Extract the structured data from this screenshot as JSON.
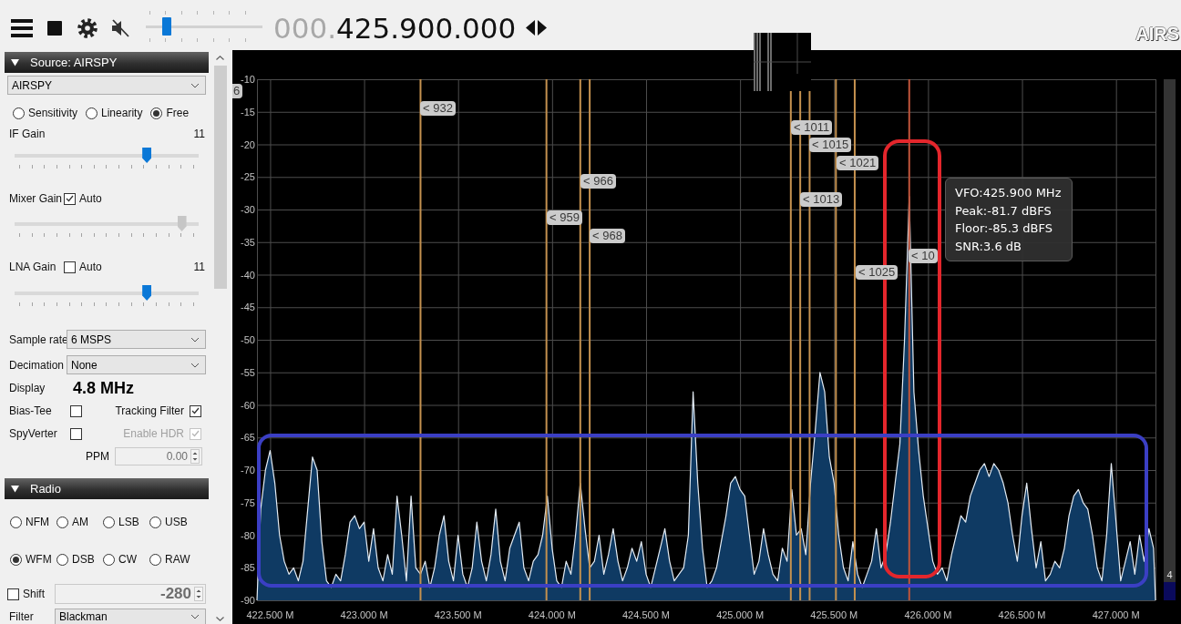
{
  "toolbar": {
    "running": true,
    "muted": true,
    "volume": {
      "level": 0.15
    },
    "frequency": {
      "leading": "000.",
      "main": "425.900.000"
    },
    "logo": "AIRS"
  },
  "source_panel": {
    "title": "Source: AIRSPY",
    "expanded": true,
    "device": "AIRSPY",
    "modes": [
      {
        "label": "Sensitivity",
        "selected": false
      },
      {
        "label": "Linearity",
        "selected": false
      },
      {
        "label": "Free",
        "selected": true
      }
    ],
    "gains": [
      {
        "label": "IF Gain",
        "value": "11",
        "level": 0.73,
        "disabled": false
      },
      {
        "label": "Mixer Gain",
        "auto": {
          "label": "Auto",
          "checked": true
        },
        "level": 0.93,
        "disabled": true
      },
      {
        "label": "LNA Gain",
        "auto": {
          "label": "Auto",
          "checked": false
        },
        "value": "11",
        "level": 0.73,
        "disabled": false
      }
    ],
    "sample_rate": {
      "label": "Sample rate",
      "value": "6 MSPS"
    },
    "decimation": {
      "label": "Decimation",
      "value": "None"
    },
    "display": {
      "label": "Display",
      "value": "4.8 MHz"
    },
    "options": [
      {
        "label": "Bias-Tee",
        "checked": false,
        "disabled": false
      },
      {
        "label": "Tracking Filter",
        "checked": true,
        "disabled": false
      },
      {
        "label": "SpyVerter",
        "checked": false,
        "disabled": false
      },
      {
        "label": "Enable HDR",
        "checked": true,
        "disabled": true
      }
    ],
    "ppm": {
      "label": "PPM",
      "value": "0.00",
      "disabled": true
    }
  },
  "radio_panel": {
    "title": "Radio",
    "expanded": true,
    "modes": [
      {
        "label": "NFM",
        "selected": false
      },
      {
        "label": "AM",
        "selected": false
      },
      {
        "label": "LSB",
        "selected": false
      },
      {
        "label": "USB",
        "selected": false
      },
      {
        "label": "WFM",
        "selected": true
      },
      {
        "label": "DSB",
        "selected": false
      },
      {
        "label": "CW",
        "selected": false
      },
      {
        "label": "RAW",
        "selected": false
      }
    ],
    "shift": {
      "label": "Shift",
      "checked": false,
      "value": "-280"
    },
    "filter": {
      "label": "Filter",
      "value": "Blackman"
    }
  },
  "spectrum": {
    "chart_data": {
      "type": "area",
      "grid": true,
      "xlim": [
        422.43,
        427.21
      ],
      "ylim": [
        -90,
        -10
      ],
      "xticks": [
        {
          "value": 422.5,
          "label": "422.500 M"
        },
        {
          "value": 423,
          "label": "423.000 M"
        },
        {
          "value": 423.5,
          "label": "423.500 M"
        },
        {
          "value": 424,
          "label": "424.000 M"
        },
        {
          "value": 424.5,
          "label": "424.500 M"
        },
        {
          "value": 425,
          "label": "425.000 M"
        },
        {
          "value": 425.5,
          "label": "425.500 M"
        },
        {
          "value": 426,
          "label": "426.000 M"
        },
        {
          "value": 426.5,
          "label": "426.500 M"
        },
        {
          "value": 427,
          "label": "427.000 M"
        }
      ],
      "yticks": [
        -10,
        -15,
        -20,
        -25,
        -30,
        -35,
        -40,
        -45,
        -50,
        -55,
        -60,
        -65,
        -70,
        -75,
        -80,
        -85,
        -90
      ],
      "x": [
        422.43,
        422.45,
        422.475,
        422.5,
        422.525,
        422.55,
        422.575,
        422.6,
        422.625,
        422.65,
        422.675,
        422.7,
        422.725,
        422.75,
        422.775,
        422.8,
        422.825,
        422.85,
        422.875,
        422.9,
        422.925,
        422.95,
        422.975,
        423,
        423.025,
        423.05,
        423.075,
        423.1,
        423.125,
        423.15,
        423.175,
        423.2,
        423.225,
        423.25,
        423.275,
        423.3,
        423.325,
        423.35,
        423.375,
        423.4,
        423.425,
        423.45,
        423.475,
        423.5,
        423.525,
        423.55,
        423.575,
        423.6,
        423.625,
        423.65,
        423.675,
        423.7,
        423.725,
        423.75,
        423.775,
        423.8,
        423.825,
        423.85,
        423.875,
        423.9,
        423.925,
        423.95,
        423.975,
        424,
        424.025,
        424.05,
        424.075,
        424.1,
        424.125,
        424.15,
        424.175,
        424.2,
        424.225,
        424.25,
        424.275,
        424.3,
        424.325,
        424.35,
        424.375,
        424.4,
        424.425,
        424.45,
        424.475,
        424.5,
        424.525,
        424.55,
        424.575,
        424.6,
        424.625,
        424.65,
        424.675,
        424.7,
        424.725,
        424.75,
        424.775,
        424.8,
        424.825,
        424.85,
        424.875,
        424.9,
        424.925,
        424.95,
        424.975,
        425,
        425.025,
        425.05,
        425.075,
        425.1,
        425.125,
        425.15,
        425.175,
        425.2,
        425.225,
        425.25,
        425.275,
        425.3,
        425.325,
        425.35,
        425.375,
        425.4,
        425.425,
        425.45,
        425.475,
        425.5,
        425.525,
        425.55,
        425.575,
        425.6,
        425.625,
        425.65,
        425.675,
        425.7,
        425.725,
        425.75,
        425.775,
        425.8,
        425.825,
        425.85,
        425.875,
        425.9,
        425.925,
        425.95,
        425.975,
        426,
        426.025,
        426.05,
        426.075,
        426.1,
        426.125,
        426.15,
        426.175,
        426.2,
        426.225,
        426.25,
        426.275,
        426.3,
        426.325,
        426.35,
        426.375,
        426.4,
        426.425,
        426.45,
        426.475,
        426.5,
        426.525,
        426.55,
        426.575,
        426.6,
        426.625,
        426.65,
        426.675,
        426.7,
        426.725,
        426.75,
        426.775,
        426.8,
        426.825,
        426.85,
        426.875,
        426.9,
        426.925,
        426.95,
        426.975,
        427,
        427.025,
        427.05,
        427.075,
        427.1,
        427.125,
        427.15,
        427.175,
        427.2,
        427.21
      ],
      "series": [
        {
          "color": "#0f3a63",
          "values": [
            -90,
            -76,
            -70,
            -67,
            -72,
            -80,
            -84,
            -86,
            -85,
            -87,
            -84,
            -76,
            -68,
            -70,
            -81,
            -87,
            -88,
            -86,
            -87,
            -83,
            -78,
            -77,
            -79,
            -78,
            -84,
            -79,
            -85,
            -87,
            -83,
            -86,
            -74,
            -80,
            -87,
            -74,
            -85,
            -86,
            -84,
            -88,
            -85,
            -80,
            -77,
            -84,
            -87,
            -80,
            -86,
            -88,
            -85,
            -78,
            -84,
            -87,
            -83,
            -76,
            -84,
            -87,
            -82,
            -80,
            -78,
            -85,
            -87,
            -84,
            -83,
            -80,
            -74,
            -82,
            -87,
            -88,
            -84,
            -86,
            -80,
            -72,
            -79,
            -85,
            -84,
            -80,
            -86,
            -83,
            -79,
            -84,
            -87,
            -85,
            -82,
            -84,
            -81,
            -86,
            -88,
            -85,
            -82,
            -79,
            -84,
            -87,
            -86,
            -85,
            -80,
            -58,
            -72,
            -82,
            -88,
            -87,
            -85,
            -81,
            -77,
            -72,
            -71,
            -73,
            -74,
            -80,
            -86,
            -84,
            -79,
            -83,
            -86,
            -87,
            -82,
            -84,
            -73,
            -80,
            -79,
            -83,
            -72,
            -64,
            -55,
            -58,
            -68,
            -72,
            -80,
            -85,
            -87,
            -81,
            -86,
            -88,
            -86,
            -84,
            -79,
            -85,
            -83,
            -78,
            -72,
            -66,
            -50,
            -28,
            -58,
            -67,
            -74,
            -79,
            -84,
            -86,
            -85,
            -87,
            -83,
            -80,
            -77,
            -78,
            -74,
            -72,
            -70,
            -69,
            -71,
            -69,
            -70,
            -72,
            -75,
            -80,
            -84,
            -77,
            -72,
            -79,
            -85,
            -81,
            -87,
            -86,
            -84,
            -85,
            -82,
            -77,
            -74,
            -73,
            -75,
            -76,
            -80,
            -85,
            -87,
            -80,
            -69,
            -78,
            -87,
            -84,
            -81,
            -86,
            -80,
            -84,
            -79,
            -82,
            -90
          ]
        }
      ],
      "ref_lines": [
        {
          "axis": "x",
          "value": 423.3,
          "color": "#c4914f"
        },
        {
          "axis": "x",
          "value": 423.97,
          "color": "#c4914f"
        },
        {
          "axis": "x",
          "value": 424.15,
          "color": "#c4914f"
        },
        {
          "axis": "x",
          "value": 424.2,
          "color": "#c4914f"
        },
        {
          "axis": "x",
          "value": 425.27,
          "color": "#c4914f"
        },
        {
          "axis": "x",
          "value": 425.32,
          "color": "#c4914f"
        },
        {
          "axis": "x",
          "value": 425.37,
          "color": "#c4914f"
        },
        {
          "axis": "x",
          "value": 425.51,
          "color": "#c4914f"
        },
        {
          "axis": "x",
          "value": 425.61,
          "color": "#c4914f"
        },
        {
          "axis": "x",
          "value": 425.9,
          "color": "#c0543a"
        }
      ]
    },
    "markers": [
      {
        "label": "6"
      },
      {
        "label": "< 932"
      },
      {
        "label": "< 1011"
      },
      {
        "label": "< 1015"
      },
      {
        "label": "< 1021"
      },
      {
        "label": "< 966"
      },
      {
        "label": "< 1013"
      },
      {
        "label": "< 959"
      },
      {
        "label": "< 968"
      },
      {
        "label": "< 10"
      },
      {
        "label": "< 1025"
      }
    ],
    "tooltip": [
      "VFO:425.900 MHz",
      "Peak:-81.7 dBFS",
      "Floor:-85.3 dBFS",
      "SNR:3.6 dB"
    ],
    "side_meter": {
      "value": "4",
      "level": 0.035
    }
  },
  "annotations": [
    {
      "kind": "vfo_outline",
      "color": "#e4262c"
    },
    {
      "kind": "band_outline",
      "color": "#3b3fc4"
    }
  ]
}
